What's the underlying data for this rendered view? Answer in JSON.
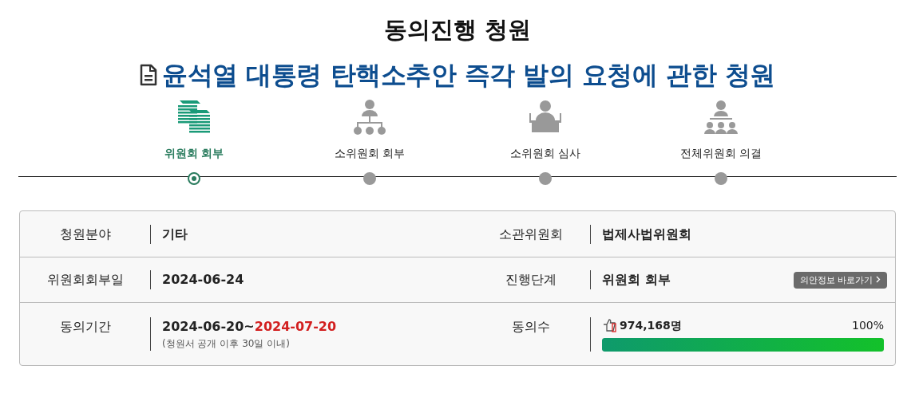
{
  "page_title": "동의진행 청원",
  "petition_title": "윤석열 대통령 탄핵소추안 즉각 발의 요청에 관한 청원",
  "steps": [
    {
      "kind": "papers",
      "label": "위원회 회부",
      "selected": true
    },
    {
      "kind": "hierarchy",
      "label": "소위원회 회부",
      "selected": false
    },
    {
      "kind": "podium",
      "label": "소위원회 심사",
      "selected": false
    },
    {
      "kind": "assembly",
      "label": "전체위원회 의결",
      "selected": false
    }
  ],
  "info": {
    "field_label": "청원분야",
    "field_value": "기타",
    "committee_label": "소관위원회",
    "committee_value": "법제사법위원회",
    "referral_label": "위원회회부일",
    "referral_value": "2024-06-24",
    "stage_label": "진행단계",
    "stage_value": "위원회 회부",
    "bill_link": "의안정보 바로가기",
    "period_label": "동의기간",
    "period_start": "2024-06-20~",
    "period_end": "2024-07-20",
    "period_note": "(청원서 공개 이후 30일 이내)",
    "agree_label": "동의수",
    "agree_count": "974,168명",
    "agree_percent": "100%",
    "level": 1
  }
}
